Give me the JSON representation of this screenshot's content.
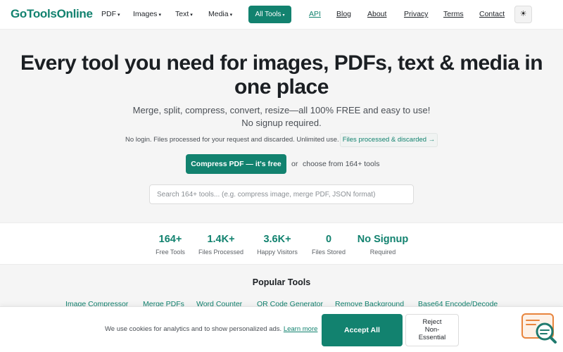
{
  "nav": {
    "logo": "GoToolsOnline",
    "dropdowns": [
      {
        "label": "PDF",
        "caret": "▾"
      },
      {
        "label": "Images",
        "caret": "▾"
      },
      {
        "label": "Text",
        "caret": "▾"
      },
      {
        "label": "Media",
        "caret": "▾"
      }
    ],
    "all_tools": {
      "label": "All Tools",
      "caret": "▾"
    },
    "links": [
      "API",
      "Blog",
      "About",
      "Privacy",
      "Terms",
      "Contact"
    ],
    "active_link": "API",
    "theme_icon": "☀"
  },
  "hero": {
    "title": "Every tool you need for images, PDFs, text & media in one place",
    "subtitle": "Merge, split, compress, convert, resize—all 100% FREE and easy to use! No signup required.",
    "note": "No login. Files processed for your request and discarded. Unlimited use.",
    "badge": "Files processed & discarded →",
    "cta": "Compress PDF — it's free",
    "or": "or",
    "choose": "choose from 164+ tools",
    "search_placeholder": "Search 164+ tools... (e.g. compress image, merge PDF, JSON format)"
  },
  "stats": [
    {
      "value": "164+",
      "label": "Free Tools"
    },
    {
      "value": "1.4K+",
      "label": "Files Processed"
    },
    {
      "value": "3.6K+",
      "label": "Happy Visitors"
    },
    {
      "value": "0",
      "label": "Files Stored"
    },
    {
      "value": "No Signup",
      "label": "Required"
    }
  ],
  "popular": {
    "title": "Popular Tools",
    "links": [
      "Image Compressor",
      "Merge PDFs",
      "Word Counter",
      "QR Code Generator",
      "Remove Background",
      "Base64 Encode/Decode"
    ]
  },
  "cookie": {
    "text": "We use cookies for analytics and to show personalized ads.",
    "link": "Learn more",
    "accept": "Accept All",
    "reject": [
      "Reject",
      "Non-",
      "Essential"
    ]
  },
  "colors": {
    "accent": "#12826f",
    "widget_orange": "#e8843c",
    "widget_teal": "#1f7a6e"
  },
  "icons": {
    "theme": "sun-icon",
    "chat": "chat-search-icon",
    "caret": "chevron-down-icon"
  }
}
